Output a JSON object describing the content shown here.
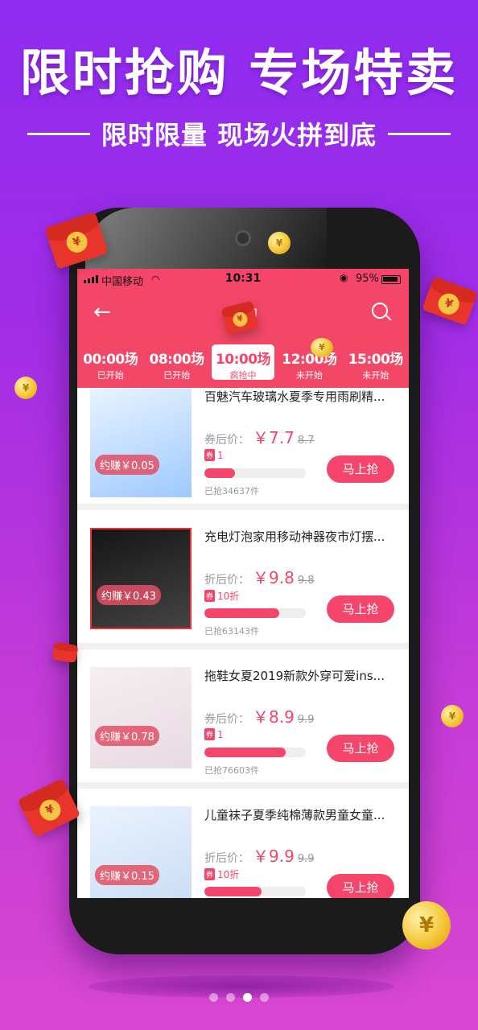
{
  "headline": "限时抢购 专场特卖",
  "subline": "限时限量 现场火拼到底",
  "status_bar": {
    "carrier": "中国移动",
    "time": "10:31",
    "battery": "95%"
  },
  "nav": {
    "title": "抢购",
    "back_icon": "back-arrow-icon",
    "search_icon": "search-icon"
  },
  "tabs": [
    {
      "time": "00:00场",
      "status": "已开始",
      "active": false
    },
    {
      "time": "08:00场",
      "status": "已开始",
      "active": false
    },
    {
      "time": "10:00场",
      "status": "疯抢中",
      "active": true
    },
    {
      "time": "12:00场",
      "status": "未开始",
      "active": false
    },
    {
      "time": "15:00场",
      "status": "未开始",
      "active": false
    }
  ],
  "products": [
    {
      "title": "百魅汽车玻璃水夏季专用雨刷精...",
      "earn": "约赚￥0.05",
      "price_label": "券后价：",
      "price": "￥7.7",
      "original": "8.7",
      "coupon_badge": "券",
      "coupon": "1",
      "progress": 0.3,
      "sold": "已抢34637件",
      "button": "马上抢"
    },
    {
      "title": "充电灯泡家用移动神器夜市灯摆...",
      "earn": "约赚￥0.43",
      "price_label": "折后价：",
      "price": "￥9.8",
      "original": "9.8",
      "coupon_badge": "券",
      "coupon": "10折",
      "progress": 0.74,
      "sold": "已抢63143件",
      "button": "马上抢"
    },
    {
      "title": "拖鞋女夏2019新款外穿可爱ins...",
      "earn": "约赚￥0.78",
      "price_label": "券后价：",
      "price": "￥8.9",
      "original": "9.9",
      "coupon_badge": "券",
      "coupon": "1",
      "progress": 0.8,
      "sold": "已抢76603件",
      "button": "马上抢"
    },
    {
      "title": "儿童袜子夏季纯棉薄款男童女童...",
      "earn": "约赚￥0.15",
      "price_label": "折后价：",
      "price": "￥9.9",
      "original": "9.9",
      "coupon_badge": "券",
      "coupon": "10折",
      "progress": 0.56,
      "sold": "",
      "button": "马上抢"
    }
  ],
  "pager": {
    "count": 4,
    "active_index": 2
  },
  "colors": {
    "accent": "#f5456a",
    "bg_top": "#8f2cf0",
    "bg_bottom": "#d947d2"
  }
}
